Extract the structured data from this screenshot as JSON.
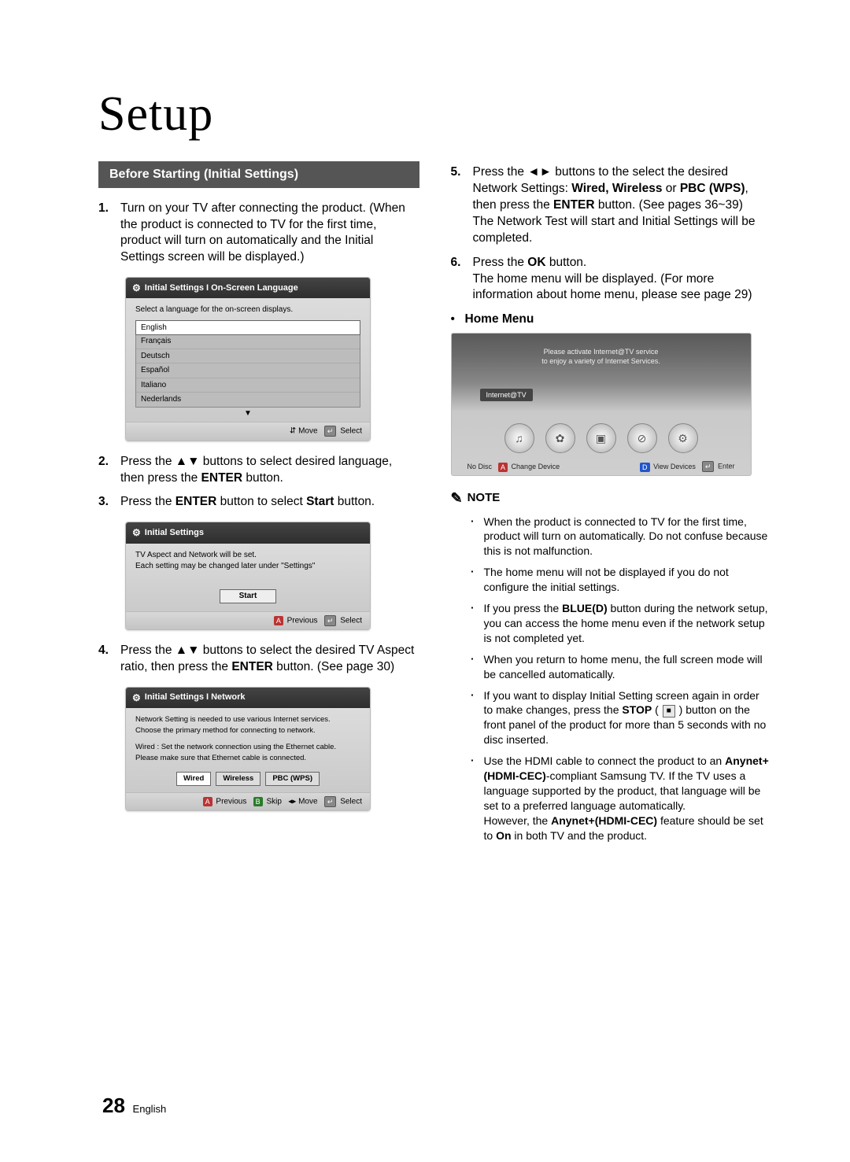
{
  "page": {
    "title": "Setup",
    "section_heading": "Before Starting (Initial Settings)",
    "number": "28",
    "lang_label": "English"
  },
  "steps_left": [
    {
      "n": "1.",
      "t": "Turn on your TV after connecting the product. (When the product is connected to TV for the first time, product will turn on automatically and the Initial Settings screen will be displayed.)"
    },
    {
      "n": "2.",
      "t_pre": "Press the ▲▼ buttons to select desired language, then press the ",
      "t_bold": "ENTER",
      "t_post": " button."
    },
    {
      "n": "3.",
      "t_pre": "Press the ",
      "t_bold": "ENTER",
      "t_mid": " button to select ",
      "t_bold2": "Start",
      "t_post": " button."
    },
    {
      "n": "4.",
      "t_pre": "Press the ▲▼ buttons to select the desired TV Aspect ratio, then press the ",
      "t_bold": "ENTER",
      "t_post": " button. (See page 30)"
    }
  ],
  "steps_right": [
    {
      "n": "5.",
      "t_pre": "Press the ◄► buttons to the select the desired Network Settings: ",
      "opts": "Wired, Wireless",
      "or": " or ",
      "opt3": "PBC (WPS)",
      "t_mid": ", then press the ",
      "t_bold": "ENTER",
      "t_post": " button. (See pages 36~39)\nThe Network Test will start and Initial Settings will be completed."
    },
    {
      "n": "6.",
      "t_pre": "Press the ",
      "t_bold": "OK",
      "t_post": " button.\nThe home menu will be displayed. (For more information about home menu, please see page 29)"
    }
  ],
  "sub_bullet": {
    "dot": "•",
    "label": "Home Menu"
  },
  "ui_lang": {
    "title": "Initial Settings I On-Screen Language",
    "prompt": "Select a language for the on-screen displays.",
    "items": [
      "English",
      "Français",
      "Deutsch",
      "Español",
      "Italiano",
      "Nederlands"
    ],
    "footer_move": "Move",
    "footer_select": "Select"
  },
  "ui_start": {
    "title": "Initial Settings",
    "line1": "TV Aspect and Network will be set.",
    "line2": "Each setting may be changed later under \"Settings\"",
    "button": "Start",
    "footer_prev": "Previous",
    "footer_select": "Select"
  },
  "ui_net": {
    "title": "Initial Settings I Network",
    "line1": "Network Setting is needed to use various Internet services.",
    "line2": "Choose the primary method for connecting to network.",
    "line3": "Wired : Set the network connection using the Ethernet cable.",
    "line4": "Please make sure that Ethernet cable is connected.",
    "btn1": "Wired",
    "btn2": "Wireless",
    "btn3": "PBC (WPS)",
    "footer_prev": "Previous",
    "footer_skip": "Skip",
    "footer_move": "Move",
    "footer_select": "Select"
  },
  "home": {
    "activate1": "Please activate Internet@TV service",
    "activate2": "to enjoy a variety of Internet Services.",
    "tab": "Internet@TV",
    "nodisc": "No Disc",
    "change": "Change Device",
    "view": "View Devices",
    "enter": "Enter"
  },
  "note": {
    "heading": "NOTE",
    "items": [
      "When the product is connected to TV for the first time, product will turn on automatically. Do not confuse because this is not malfunction.",
      "The home menu will not be displayed if you do not configure the initial settings.",
      "If you press the <b>BLUE(D)</b> button during the network setup, you can access the home menu even if the network setup is not completed yet.",
      "When you return to home menu, the full screen mode will be cancelled automatically.",
      "If you want to display Initial Setting screen again in order to make changes, press the <b>STOP</b> ( <span class=\"stop-box\">■</span> ) button on the front panel of the product for more than 5 seconds with no disc inserted.",
      "Use the HDMI cable to connect the product to an <b>Anynet+(HDMI-CEC)</b>-compliant Samsung TV. If the TV uses a language supported by the product, that language will be set to a preferred language automatically.<br>However, the <b>Anynet+(HDMI-CEC)</b> feature should be set to <b>On</b> in both TV and the product."
    ]
  }
}
